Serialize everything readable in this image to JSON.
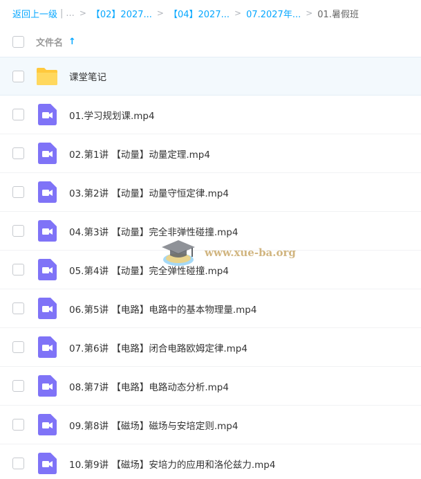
{
  "breadcrumb": {
    "back": "返回上一级",
    "ellipsis": "...",
    "items": [
      "【02】2027...",
      "【04】2027...",
      "07.2027年..."
    ],
    "current": "01.暑假班"
  },
  "header": {
    "column_name": "文件名",
    "sort_icon": "arrow-up-icon"
  },
  "files": [
    {
      "name": "课堂笔记",
      "type": "folder"
    },
    {
      "name": "01.学习规划课.mp4",
      "type": "video"
    },
    {
      "name": "02.第1讲 【动量】动量定理.mp4",
      "type": "video"
    },
    {
      "name": "03.第2讲 【动量】动量守恒定律.mp4",
      "type": "video"
    },
    {
      "name": "04.第3讲 【动量】完全非弹性碰撞.mp4",
      "type": "video"
    },
    {
      "name": "05.第4讲 【动量】完全弹性碰撞.mp4",
      "type": "video"
    },
    {
      "name": "06.第5讲 【电路】电路中的基本物理量.mp4",
      "type": "video"
    },
    {
      "name": "07.第6讲 【电路】闭合电路欧姆定律.mp4",
      "type": "video"
    },
    {
      "name": "08.第7讲 【电路】电路动态分析.mp4",
      "type": "video"
    },
    {
      "name": "09.第8讲 【磁场】磁场与安培定则.mp4",
      "type": "video"
    },
    {
      "name": "10.第9讲 【磁场】安培力的应用和洛伦兹力.mp4",
      "type": "video"
    }
  ],
  "watermark": {
    "text": "www.xue-ba.org",
    "icon": "graduation-cap-icon"
  },
  "colors": {
    "accent": "#06a7ff",
    "folder": "#ffc93d",
    "video": "#7f73f7",
    "selected_row": "#f3f9fd"
  }
}
